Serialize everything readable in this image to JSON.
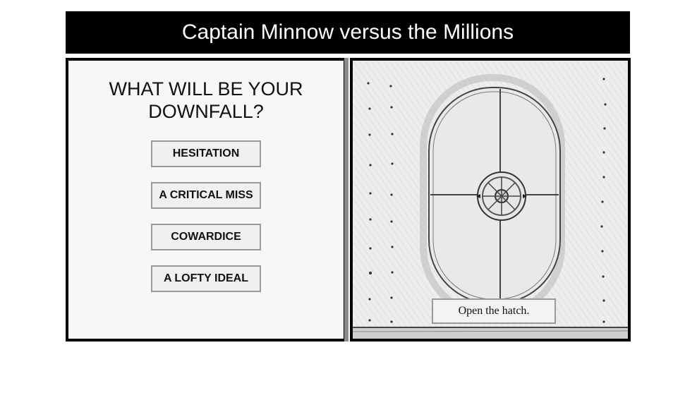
{
  "game": {
    "title": "Captain Minnow versus the Millions"
  },
  "choice_panel": {
    "question": "WHAT WILL BE YOUR DOWNFALL?",
    "options": [
      "HESITATION",
      "A CRITICAL MISS",
      "COWARDICE",
      "A LOFTY IDEAL"
    ]
  },
  "scene": {
    "illustration": "hatch-door-pencil-sketch",
    "action_label": "Open the hatch."
  },
  "colors": {
    "title_bar": "#000000",
    "title_text": "#ffffff",
    "panel_border": "#000000",
    "divider": "#8c8c8c"
  }
}
